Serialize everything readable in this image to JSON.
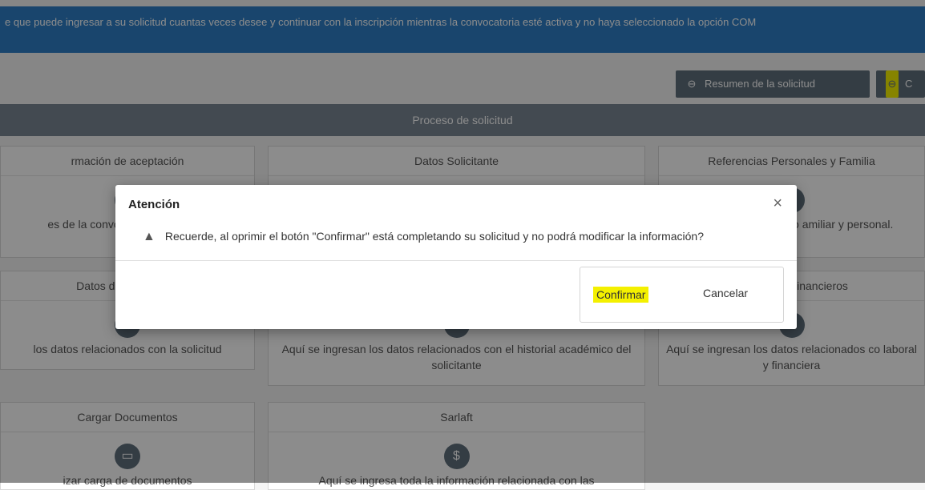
{
  "banner": {
    "text": "e que puede ingresar a su solicitud cuantas veces desee y continuar con la inscripción mientras la convocatoria esté activa y no haya seleccionado la opción COM"
  },
  "toolbar": {
    "summary_label": "Resumen de la solicitud",
    "second_label": "C"
  },
  "section": {
    "title": "Proceso de solicitud"
  },
  "cards": [
    {
      "title": "rmación de aceptación",
      "desc": "es de la convocator condiciones"
    },
    {
      "title": "Datos Solicitante",
      "desc": ""
    },
    {
      "title": "Referencias Personales y Familia",
      "desc": "datos relacionados co amiliar y personal."
    },
    {
      "title": "Datos de la Solicitud",
      "desc": "los datos relacionados con la solicitud"
    },
    {
      "title": "",
      "desc": "Aquí se ingresan los datos relacionados con el historial académico del solicitante"
    },
    {
      "title": "aborales y Financieros",
      "desc": "Aquí se ingresan los datos relacionados co laboral y financiera"
    },
    {
      "title": "Cargar Documentos",
      "desc": "izar carga de documentos"
    },
    {
      "title": "Sarlaft",
      "desc": "Aquí se ingresa toda la información relacionada con las"
    }
  ],
  "modal": {
    "title": "Atención",
    "close": "×",
    "message": "Recuerde, al oprimir el botón \"Confirmar\" está completando su solicitud y no podrá modificar la información?",
    "confirm": "Confirmar",
    "cancel": "Cancelar"
  },
  "colors": {
    "banner": "#2f7fc6",
    "button": "#5f6f7c",
    "highlight": "#f4f000"
  }
}
